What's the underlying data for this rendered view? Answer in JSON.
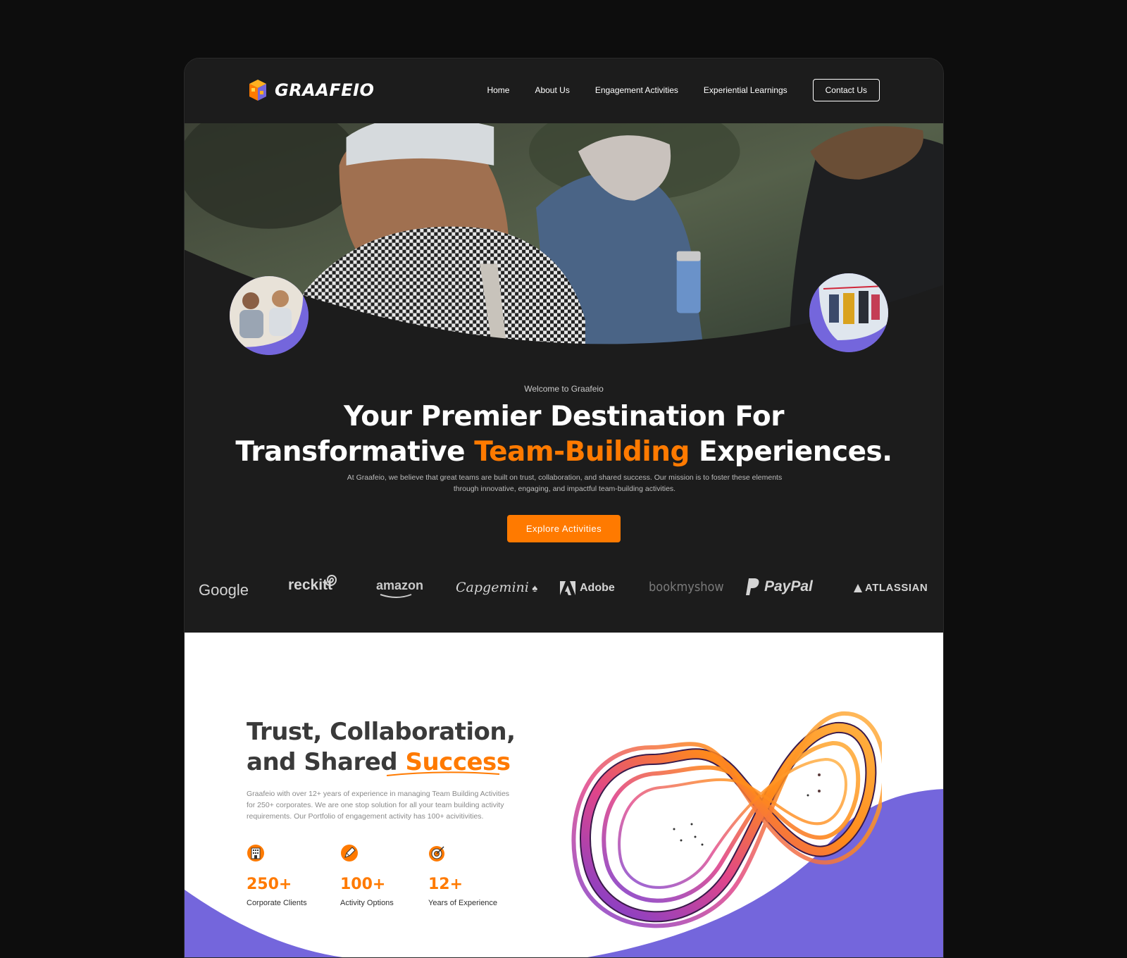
{
  "brand": {
    "name": "GRAAFEIO"
  },
  "nav": {
    "links": [
      "Home",
      "About Us",
      "Engagement Activities",
      "Experiential Learnings"
    ],
    "contact": "Contact Us"
  },
  "hero": {
    "welcome": "Welcome to Graafeio",
    "headline_line1": "Your Premier Destination For",
    "headline_pre": "Transformative ",
    "headline_highlight": "Team-Building",
    "headline_post": " Experiences.",
    "description": "At Graafeio, we believe that great teams are built on trust, collaboration, and shared success. Our mission is to foster these elements through innovative, engaging, and impactful team-building activities.",
    "cta": "Explore Activities"
  },
  "clients": [
    "Google",
    "reckitt",
    "amazon",
    "Capgemini",
    "Adobe",
    "bookmyshow",
    "PayPal",
    "ATLASSIAN"
  ],
  "about": {
    "title_line1": "Trust, Collaboration,",
    "title_pre": "and Shared ",
    "title_highlight": "Success",
    "description": "Graafeio with over 12+ years of experience in managing Team Building Activities for 250+ corporates. We are one stop solution for all your team building activity requirements. Our Portfolio of engagement activity has 100+ acivitivities.",
    "stats": [
      {
        "icon": "building-icon",
        "value": "250+",
        "label": "Corporate Clients"
      },
      {
        "icon": "pencil-icon",
        "value": "100+",
        "label": "Activity Options"
      },
      {
        "icon": "target-icon",
        "value": "12+",
        "label": "Years of Experience"
      }
    ]
  },
  "colors": {
    "accent": "#ff7a00",
    "purple": "#7466dc",
    "dark": "#1c1c1c"
  }
}
